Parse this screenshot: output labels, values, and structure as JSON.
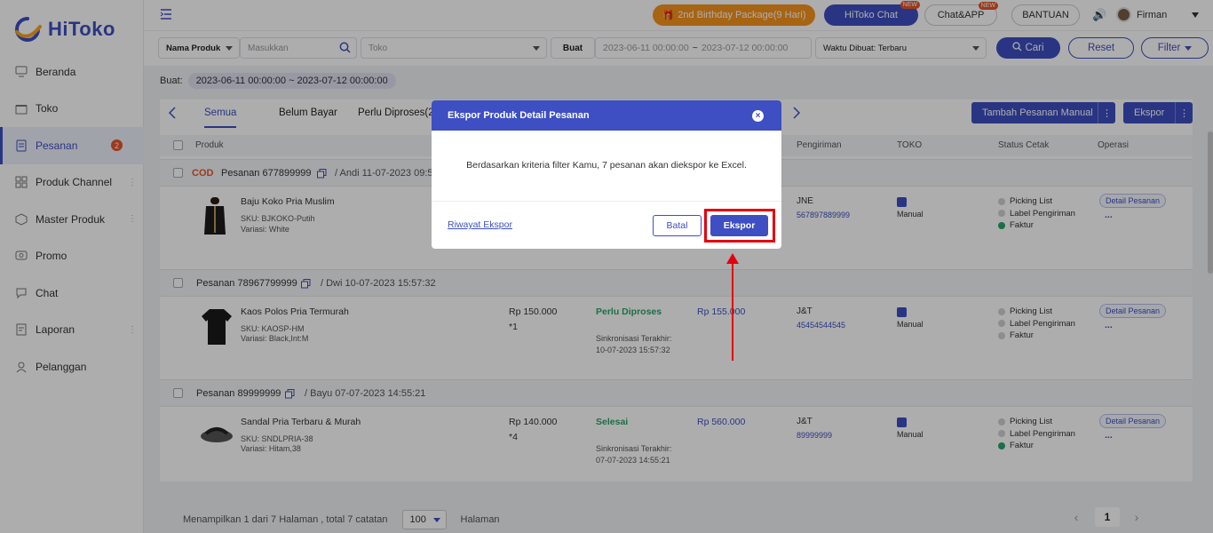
{
  "brand": {
    "name": "HiToko",
    "color": "#3d4fc2"
  },
  "sidebar": {
    "items": [
      {
        "label": "Beranda",
        "icon": "home-icon"
      },
      {
        "label": "Toko",
        "icon": "store-icon"
      },
      {
        "label": "Pesanan",
        "icon": "order-icon",
        "badge": "2",
        "active": true
      },
      {
        "label": "Produk Channel",
        "icon": "grid-icon"
      },
      {
        "label": "Master Produk",
        "icon": "box-icon"
      },
      {
        "label": "Promo",
        "icon": "promo-icon"
      },
      {
        "label": "Chat",
        "icon": "chat-icon"
      },
      {
        "label": "Laporan",
        "icon": "report-icon"
      },
      {
        "label": "Pelanggan",
        "icon": "customer-icon"
      }
    ]
  },
  "topbar": {
    "birthday": "2nd Birthday Package(9 Hari)",
    "hitoko_chat": "HiToko Chat",
    "chat_app": "Chat&APP",
    "new_tag": "NEW",
    "bantuan": "BANTUAN",
    "user": "Firman"
  },
  "filters": {
    "produk_field": "Nama Produk",
    "produk_placeholder": "Masukkan",
    "toko_placeholder": "Toko",
    "buat": "Buat",
    "date_start": "2023-06-11 00:00:00",
    "tilde": "~",
    "date_end": "2023-07-12 00:00:00",
    "sort": "Waktu Dibuat: Terbaru",
    "cari": "Cari",
    "reset": "Reset",
    "filter": "Filter"
  },
  "buat_row": {
    "label": "Buat:",
    "chip": "2023-06-11 00:00:00 ~ 2023-07-12 00:00:00"
  },
  "tabs": {
    "items": [
      "Semua",
      "Belum Bayar",
      "Perlu Diproses(2"
    ],
    "add_manual": "Tambah Pesanan Manual",
    "ekspor": "Ekspor"
  },
  "table_headers": {
    "produk": "Produk",
    "pengiriman": "Pengiriman",
    "toko": "TOKO",
    "status_cetak": "Status Cetak",
    "operasi": "Operasi"
  },
  "orders": [
    {
      "cod": "COD",
      "head": "Pesanan 677899999",
      "meta": "/ Andi 11-07-2023 09:5",
      "name": "Baju Koko Pria Muslim",
      "sku": "SKU:  BJKOKO-Putih",
      "variasi": "Variasi:  White",
      "price": "",
      "qty": "",
      "status": "",
      "sync_label": "",
      "sync_time": "",
      "total": "",
      "courier": "JNE",
      "tracking": "567897889999",
      "toko": "Manual",
      "print": [
        "Picking List",
        "Label Pengiriman",
        "Faktur"
      ],
      "detail": "Detail Pesanan",
      "more": "..."
    },
    {
      "cod": "",
      "head": "Pesanan 78967799999",
      "meta": "/ Dwi 10-07-2023 15:57:32",
      "name": "Kaos Polos Pria Termurah",
      "sku": "SKU:  KAOSP-HM",
      "variasi": "Variasi:  Black,Int:M",
      "price": "Rp 150.000",
      "qty": "*1",
      "status": "Perlu Diproses",
      "sync_label": "Sinkronisasi Terakhir:",
      "sync_time": "10-07-2023 15:57:32",
      "total": "Rp 155.000",
      "courier": "J&T",
      "tracking": "45454544545",
      "toko": "Manual",
      "print": [
        "Picking List",
        "Label Pengiriman",
        "Faktur"
      ],
      "detail": "Detail Pesanan",
      "more": "..."
    },
    {
      "cod": "",
      "head": "Pesanan 89999999",
      "meta": "/ Bayu 07-07-2023 14:55:21",
      "name": "Sandal Pria Terbaru & Murah",
      "sku": "SKU:  SNDLPRIA-38",
      "variasi": "Variasi:  Hitam,38",
      "price": "Rp 140.000",
      "qty": "*4",
      "status": "Selesai",
      "sync_label": "Sinkronisasi Terakhir:",
      "sync_time": "07-07-2023 14:55:21",
      "total": "Rp 560.000",
      "courier": "J&T",
      "tracking": "89999999",
      "toko": "Manual",
      "print": [
        "Picking List",
        "Label Pengiriman",
        "Faktur"
      ],
      "detail": "Detail Pesanan",
      "more": "..."
    }
  ],
  "footer": {
    "info": "Menampilkan 1 dari 7 Halaman , total 7 catatan",
    "page_size": "100",
    "halaman": "Halaman",
    "page": "1",
    "prev": "‹",
    "next": "›"
  },
  "modal": {
    "title": "Ekspor Produk Detail Pesanan",
    "close": "×",
    "message": "Berdasarkan kriteria filter Kamu, 7 pesanan akan diekspor ke Excel.",
    "history": "Riwayat Ekspor",
    "cancel": "Batal",
    "export": "Ekspor"
  }
}
